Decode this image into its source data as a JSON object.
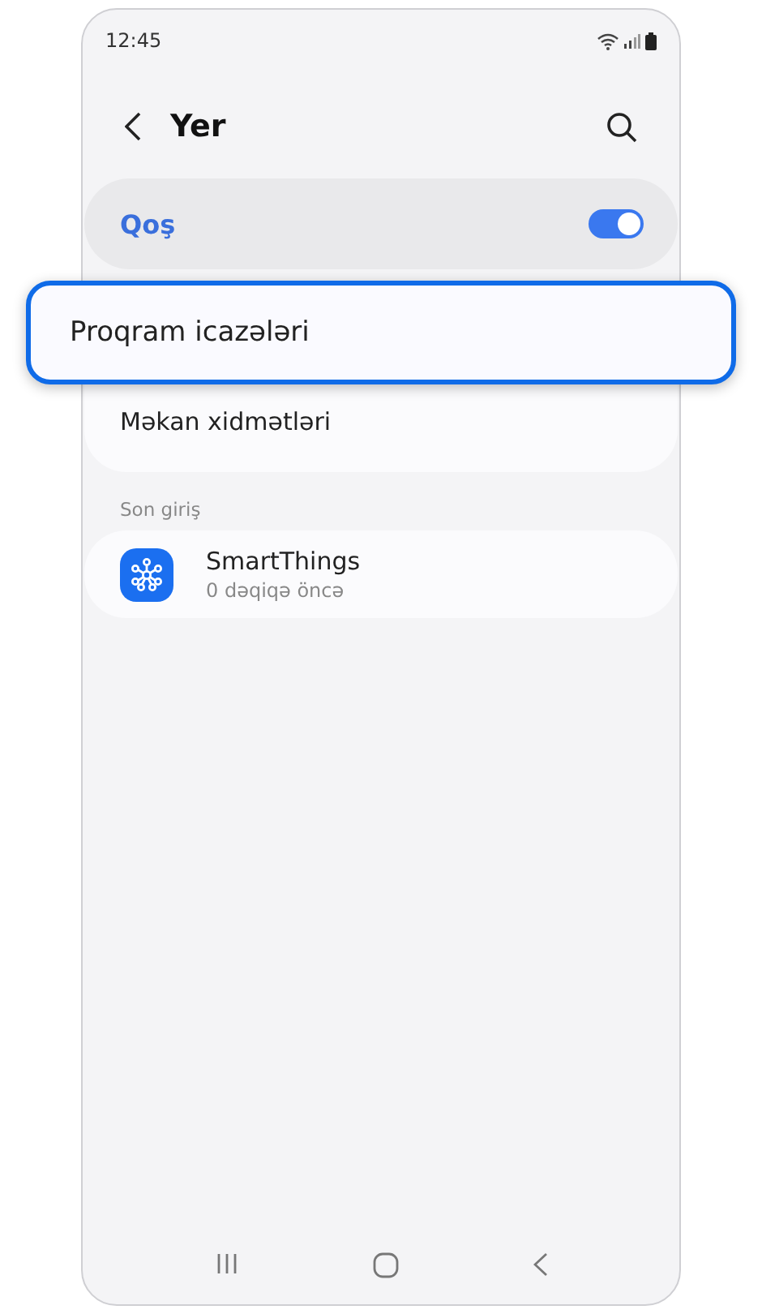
{
  "status_bar": {
    "time": "12:45"
  },
  "header": {
    "title": "Yer"
  },
  "master_switch": {
    "label": "Qoş",
    "on": true
  },
  "settings": [
    {
      "label": "Proqram icazələri",
      "highlighted": true
    },
    {
      "label": "Məkan xidmətləri",
      "highlighted": false
    }
  ],
  "recent": {
    "heading": "Son giriş",
    "items": [
      {
        "name": "SmartThings",
        "time": "0 dəqiqə öncə"
      }
    ]
  }
}
